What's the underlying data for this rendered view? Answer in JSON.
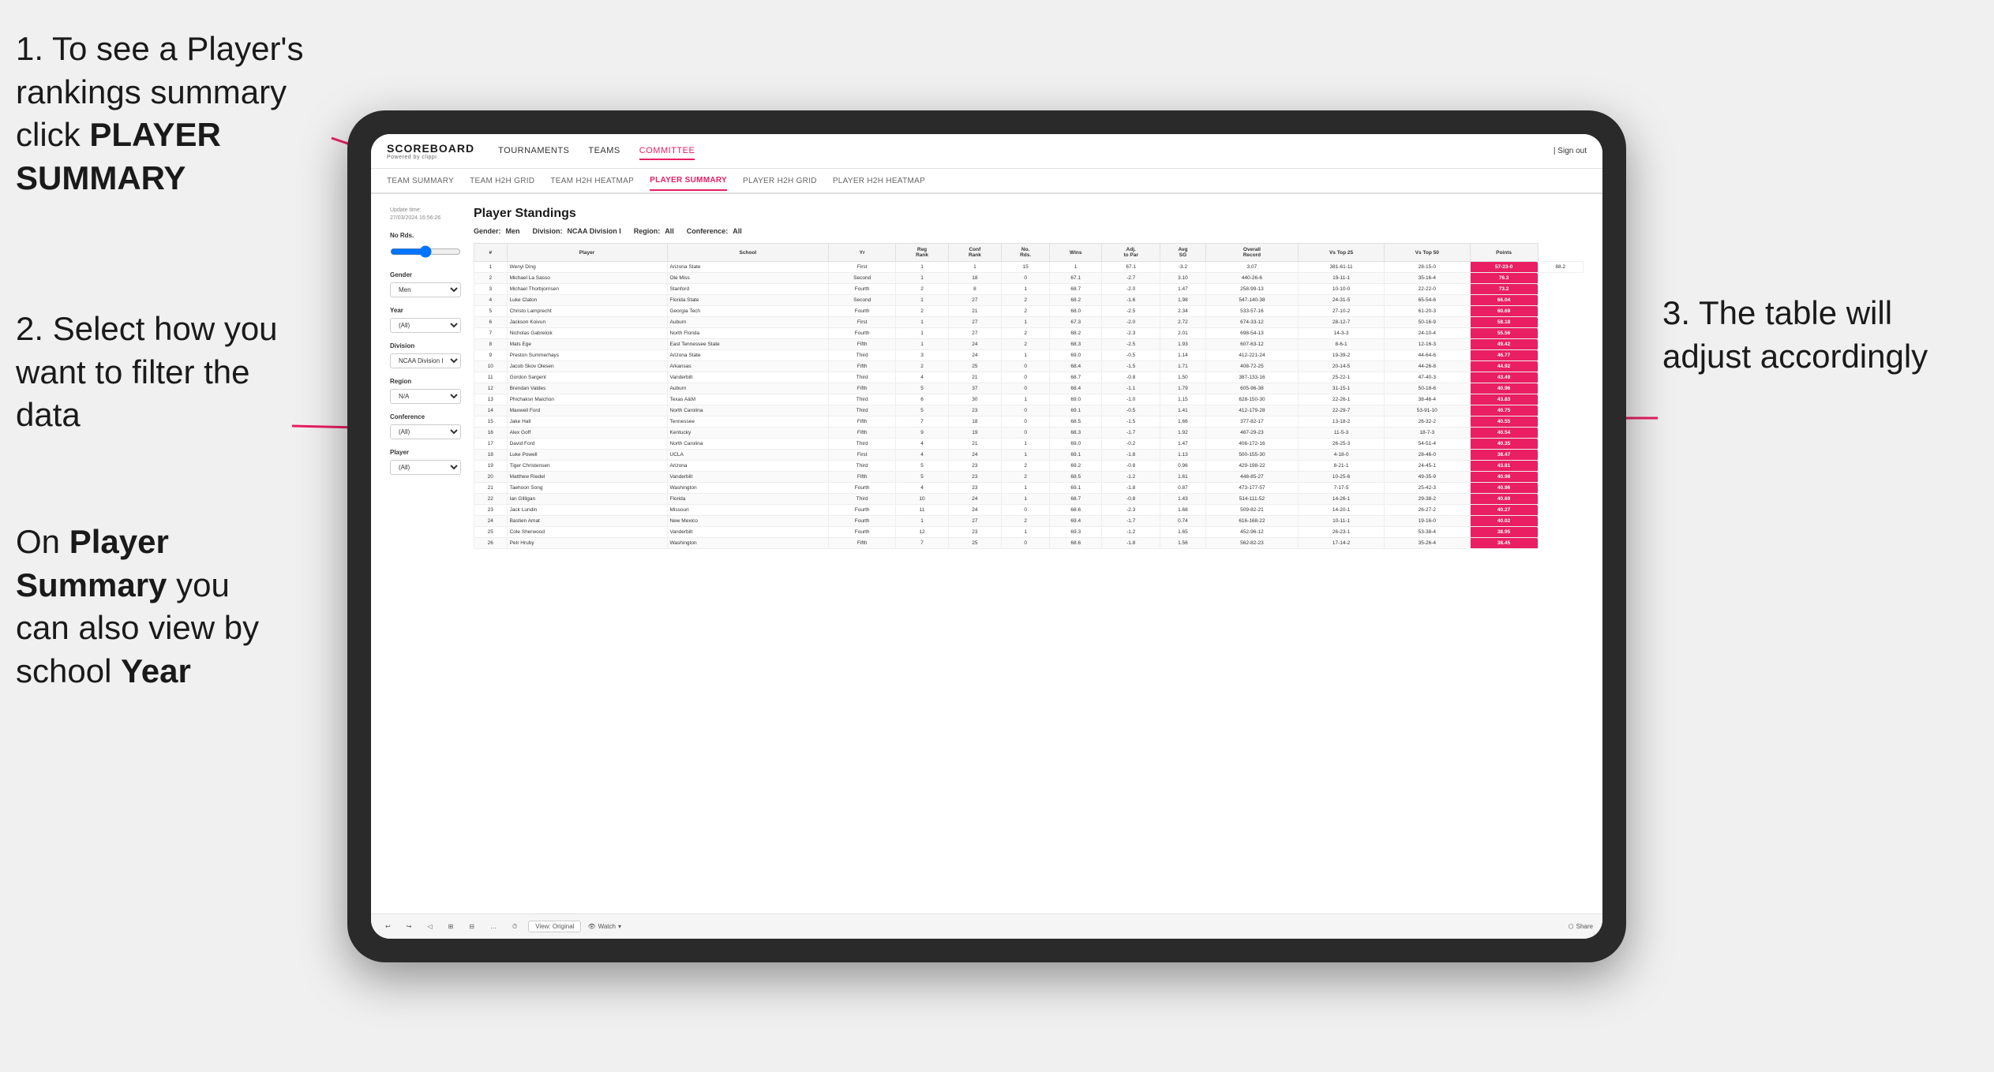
{
  "page": {
    "background": "#f0f0f0"
  },
  "instructions": {
    "step1": {
      "text_before": "1. To see a Player's rankings summary click ",
      "bold_text": "PLAYER SUMMARY"
    },
    "step2": {
      "text_before": "2. Select how you want to filter the data"
    },
    "step3_bottom": {
      "text_before": "On ",
      "bold1": "Player Summary",
      "text_mid": " you can also view by school ",
      "bold2": "Year"
    },
    "step3_right": {
      "text": "3. The table will adjust accordingly"
    }
  },
  "app": {
    "logo": "SCOREBOARD",
    "logo_sub": "Powered by clippi",
    "nav": {
      "items": [
        "TOURNAMENTS",
        "TEAMS",
        "COMMITTEE"
      ],
      "sign_out": "Sign out"
    },
    "sub_nav": {
      "items": [
        "TEAM SUMMARY",
        "TEAM H2H GRID",
        "TEAM H2H HEATMAP",
        "PLAYER SUMMARY",
        "PLAYER H2H GRID",
        "PLAYER H2H HEATMAP"
      ],
      "active": "PLAYER SUMMARY"
    },
    "update_time_label": "Update time:",
    "update_time_value": "27/03/2024 16:56:26",
    "table": {
      "title": "Player Standings",
      "gender_label": "Gender:",
      "gender_value": "Men",
      "division_label": "Division:",
      "division_value": "NCAA Division I",
      "region_label": "Region:",
      "region_value": "All",
      "conference_label": "Conference:",
      "conference_value": "All",
      "columns": [
        "#",
        "Player",
        "School",
        "Yr",
        "Reg Rank",
        "Conf Rank",
        "No. Rds.",
        "Wins",
        "Adj. to Par",
        "Avg SG",
        "Overall Record",
        "Vs Top 25",
        "Vs Top 50",
        "Points"
      ],
      "rows": [
        [
          "1",
          "Wenyi Ding",
          "Arizona State",
          "First",
          "1",
          "1",
          "15",
          "1",
          "67.1",
          "-3.2",
          "3.07",
          "381-61-11",
          "28-15-0",
          "57-23-0",
          "88.2"
        ],
        [
          "2",
          "Michael La Sasso",
          "Ole Miss",
          "Second",
          "1",
          "18",
          "0",
          "67.1",
          "-2.7",
          "3.10",
          "440-26-6",
          "19-11-1",
          "35-16-4",
          "76.3"
        ],
        [
          "3",
          "Michael Thorbjornsen",
          "Stanford",
          "Fourth",
          "2",
          "8",
          "1",
          "68.7",
          "-2.0",
          "1.47",
          "258-99-13",
          "10-10-0",
          "22-22-0",
          "73.2"
        ],
        [
          "4",
          "Luke Claton",
          "Florida State",
          "Second",
          "1",
          "27",
          "2",
          "68.2",
          "-1.6",
          "1.98",
          "547-140-38",
          "24-31-5",
          "65-54-6",
          "66.04"
        ],
        [
          "5",
          "Christo Lamprecht",
          "Georgia Tech",
          "Fourth",
          "2",
          "21",
          "2",
          "68.0",
          "-2.5",
          "2.34",
          "533-57-16",
          "27-10-2",
          "61-20-3",
          "60.69"
        ],
        [
          "6",
          "Jackson Koivun",
          "Auburn",
          "First",
          "1",
          "27",
          "1",
          "67.3",
          "-2.0",
          "2.72",
          "674-33-12",
          "28-12-7",
          "50-16-9",
          "58.18"
        ],
        [
          "7",
          "Nicholas Gabrelcik",
          "North Florida",
          "Fourth",
          "1",
          "27",
          "2",
          "68.2",
          "-2.3",
          "2.01",
          "698-54-13",
          "14-3-3",
          "24-10-4",
          "55.56"
        ],
        [
          "8",
          "Mats Ege",
          "East Tennessee State",
          "Fifth",
          "1",
          "24",
          "2",
          "68.3",
          "-2.5",
          "1.93",
          "607-63-12",
          "8-6-1",
          "12-16-3",
          "49.42"
        ],
        [
          "9",
          "Preston Summerhays",
          "Arizona State",
          "Third",
          "3",
          "24",
          "1",
          "69.0",
          "-0.5",
          "1.14",
          "412-221-24",
          "19-39-2",
          "44-64-6",
          "46.77"
        ],
        [
          "10",
          "Jacob Skov Olesen",
          "Arkansas",
          "Fifth",
          "2",
          "25",
          "0",
          "68.4",
          "-1.5",
          "1.71",
          "408-72-25",
          "20-14-5",
          "44-26-8",
          "44.92"
        ],
        [
          "11",
          "Gordon Sargent",
          "Vanderbilt",
          "Third",
          "4",
          "21",
          "0",
          "68.7",
          "-0.8",
          "1.50",
          "387-133-16",
          "25-22-1",
          "47-40-3",
          "43.49"
        ],
        [
          "12",
          "Brendan Valdes",
          "Auburn",
          "Fifth",
          "5",
          "37",
          "0",
          "68.4",
          "-1.1",
          "1.79",
          "605-96-38",
          "31-15-1",
          "50-18-6",
          "40.96"
        ],
        [
          "13",
          "Phichaksn Maichon",
          "Texas A&M",
          "Third",
          "6",
          "30",
          "1",
          "69.0",
          "-1.0",
          "1.15",
          "628-150-30",
          "22-26-1",
          "38-46-4",
          "43.83"
        ],
        [
          "14",
          "Maxwell Ford",
          "North Carolina",
          "Third",
          "5",
          "23",
          "0",
          "69.1",
          "-0.5",
          "1.41",
          "412-179-28",
          "22-29-7",
          "53-91-10",
          "40.75"
        ],
        [
          "15",
          "Jake Hall",
          "Tennessee",
          "Fifth",
          "7",
          "18",
          "0",
          "68.5",
          "-1.5",
          "1.66",
          "377-82-17",
          "13-18-2",
          "26-32-2",
          "40.55"
        ],
        [
          "16",
          "Alex Goff",
          "Kentucky",
          "Fifth",
          "9",
          "19",
          "0",
          "68.3",
          "-1.7",
          "1.92",
          "467-29-23",
          "11-5-3",
          "18-7-3",
          "40.54"
        ],
        [
          "17",
          "David Ford",
          "North Carolina",
          "Third",
          "4",
          "21",
          "1",
          "69.0",
          "-0.2",
          "1.47",
          "406-172-16",
          "26-25-3",
          "54-51-4",
          "40.35"
        ],
        [
          "18",
          "Luke Powell",
          "UCLA",
          "First",
          "4",
          "24",
          "1",
          "69.1",
          "-1.8",
          "1.13",
          "500-155-30",
          "4-18-0",
          "28-46-0",
          "38.47"
        ],
        [
          "19",
          "Tiger Christensen",
          "Arizona",
          "Third",
          "5",
          "23",
          "2",
          "69.2",
          "-0.8",
          "0.96",
          "429-198-22",
          "8-21-1",
          "24-45-1",
          "43.81"
        ],
        [
          "20",
          "Matthew Riedel",
          "Vanderbilt",
          "Fifth",
          "5",
          "23",
          "2",
          "68.5",
          "-1.2",
          "1.61",
          "448-85-27",
          "10-25-6",
          "49-35-9",
          "40.98"
        ],
        [
          "21",
          "Taehoon Song",
          "Washington",
          "Fourth",
          "4",
          "23",
          "1",
          "69.1",
          "-1.8",
          "0.87",
          "473-177-57",
          "7-17-5",
          "25-42-3",
          "40.96"
        ],
        [
          "22",
          "Ian Gilligan",
          "Florida",
          "Third",
          "10",
          "24",
          "1",
          "68.7",
          "-0.8",
          "1.43",
          "514-111-52",
          "14-26-1",
          "29-38-2",
          "40.69"
        ],
        [
          "23",
          "Jack Lundin",
          "Missouri",
          "Fourth",
          "11",
          "24",
          "0",
          "68.6",
          "-2.3",
          "1.68",
          "509-82-21",
          "14-20-1",
          "26-27-2",
          "40.27"
        ],
        [
          "24",
          "Bastien Amat",
          "New Mexico",
          "Fourth",
          "1",
          "27",
          "2",
          "69.4",
          "-1.7",
          "0.74",
          "616-168-22",
          "10-11-1",
          "19-16-0",
          "40.02"
        ],
        [
          "25",
          "Cole Sherwood",
          "Vanderbilt",
          "Fourth",
          "12",
          "23",
          "1",
          "69.3",
          "-1.2",
          "1.65",
          "452-96-12",
          "26-23-1",
          "53-38-4",
          "38.95"
        ],
        [
          "26",
          "Petr Hruby",
          "Washington",
          "Fifth",
          "7",
          "25",
          "0",
          "68.6",
          "-1.8",
          "1.56",
          "562-82-23",
          "17-14-2",
          "35-26-4",
          "38.45"
        ]
      ]
    },
    "filters": {
      "no_rds_label": "No Rds.",
      "gender_label": "Gender",
      "gender_value": "Men",
      "year_label": "Year",
      "year_value": "(All)",
      "division_label": "Division",
      "division_value": "NCAA Division I",
      "region_label": "Region",
      "region_value": "N/A",
      "conference_label": "Conference",
      "conference_value": "(All)",
      "player_label": "Player",
      "player_value": "(All)"
    },
    "toolbar": {
      "view_label": "View: Original",
      "watch_label": "Watch",
      "share_label": "Share"
    }
  }
}
